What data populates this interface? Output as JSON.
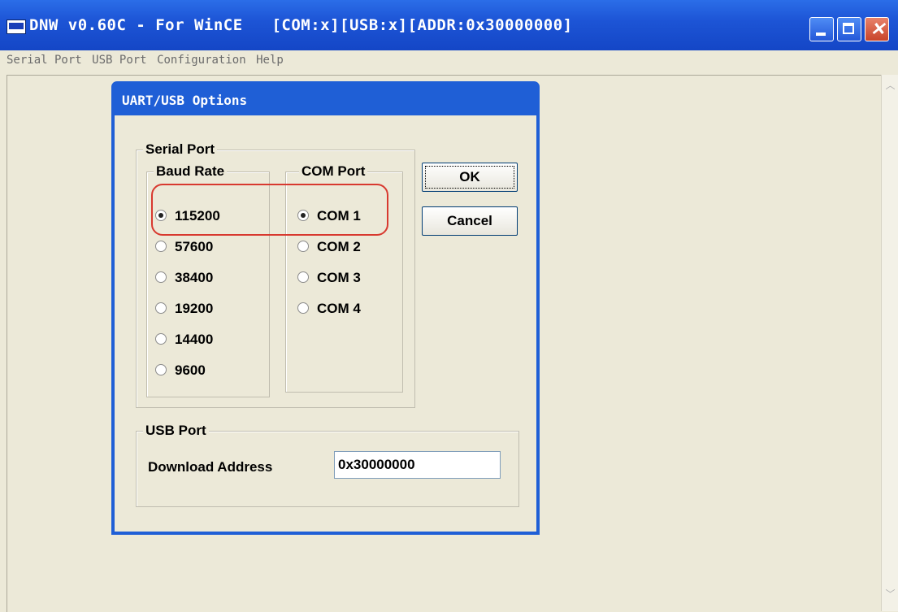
{
  "window": {
    "title": "DNW v0.60C - For WinCE   [COM:x][USB:x][ADDR:0x30000000]",
    "titlebar_color": "#1f5fd6",
    "controls": [
      "minimize-icon",
      "maximize-icon",
      "close-icon"
    ]
  },
  "menubar": {
    "items": [
      "Serial Port",
      "USB Port",
      "Configuration",
      "Help"
    ]
  },
  "dialog": {
    "title": "UART/USB Options",
    "serial_port": {
      "label": "Serial Port",
      "baud_rate": {
        "label": "Baud Rate",
        "options": [
          "115200",
          "57600",
          "38400",
          "19200",
          "14400",
          "9600"
        ],
        "selected": "115200"
      },
      "com_port": {
        "label": "COM Port",
        "options": [
          "COM 1",
          "COM 2",
          "COM 3",
          "COM 4"
        ],
        "selected": "COM 1"
      }
    },
    "buttons": {
      "ok": "OK",
      "cancel": "Cancel"
    },
    "usb_port": {
      "label": "USB Port",
      "download_address_label": "Download Address",
      "download_address_value": "0x30000000"
    }
  },
  "annotation": {
    "highlight_color": "#d8392f"
  }
}
